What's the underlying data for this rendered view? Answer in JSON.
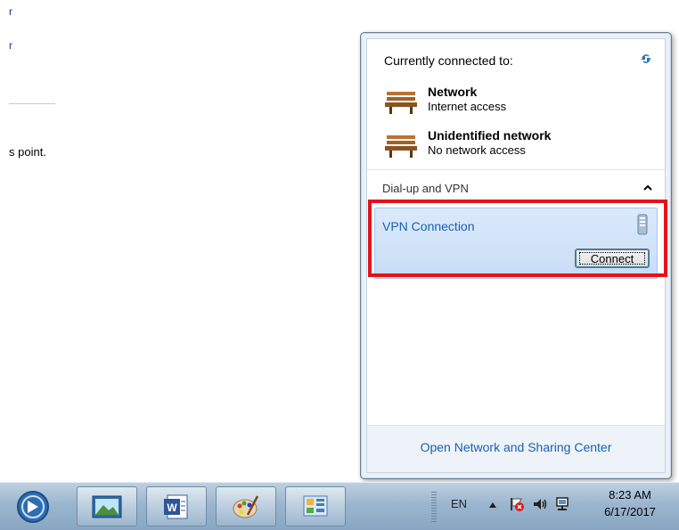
{
  "background": {
    "line1": "r",
    "line2": "r",
    "body_text": "s point."
  },
  "flyout": {
    "currently_connected_label": "Currently connected to:",
    "networks": [
      {
        "name": "Network",
        "status": "Internet access"
      },
      {
        "name": "Unidentified network",
        "status": "No network access"
      }
    ],
    "group_label": "Dial-up and VPN",
    "vpn": {
      "name": "VPN Connection",
      "connect_label": "Connect"
    },
    "footer_link": "Open Network and Sharing Center"
  },
  "taskbar": {
    "language": "EN",
    "time": "8:23 AM",
    "date": "6/17/2017",
    "pinned": [
      "remote-desktop-icon",
      "picture-viewer-icon",
      "word-icon",
      "paint-icon",
      "control-panel-icon"
    ]
  },
  "colors": {
    "highlight": "#e3121b",
    "link": "#1a5fb4"
  }
}
